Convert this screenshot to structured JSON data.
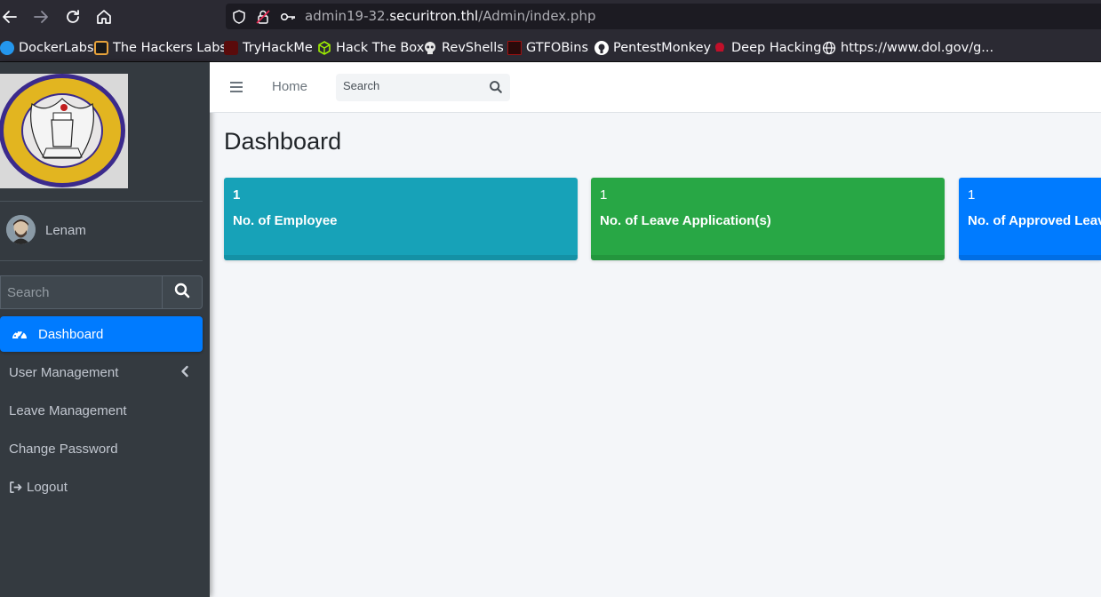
{
  "browser": {
    "url_prefix": "admin19-32.",
    "url_domain": "securitron.thl",
    "url_path": "/Admin/index.php",
    "bookmarks": [
      {
        "label": "DockerLabs",
        "icon": "docker-whale-icon",
        "color": "#2496ed"
      },
      {
        "label": "The Hackers Labs",
        "icon": "hackers-labs-icon",
        "color": "#e8a33b"
      },
      {
        "label": "TryHackMe",
        "icon": "tryhackme-icon",
        "color": "#c11111"
      },
      {
        "label": "Hack The Box",
        "icon": "hackthebox-cube-icon",
        "color": "#9fef00"
      },
      {
        "label": "RevShells",
        "icon": "skull-icon",
        "color": "#e0e0e0"
      },
      {
        "label": "GTFOBins",
        "icon": "gtfobins-icon",
        "color": "#a01010"
      },
      {
        "label": "PentestMonkey",
        "icon": "github-icon",
        "color": "#ffffff"
      },
      {
        "label": "Deep Hacking",
        "icon": "deep-hacking-icon",
        "color": "#c0102a"
      },
      {
        "label": "https://www.dol.gov/g...",
        "icon": "globe-icon",
        "color": "#fbfbfe"
      }
    ]
  },
  "sidebar": {
    "user_name": "Lenam",
    "search_placeholder": "Search",
    "items": [
      {
        "label": "Dashboard",
        "icon": "tachometer-icon",
        "active": true
      },
      {
        "label": "User Management",
        "icon": "",
        "has_submenu": true
      },
      {
        "label": "Leave Management",
        "icon": ""
      },
      {
        "label": "Change Password",
        "icon": ""
      },
      {
        "label": "Logout",
        "icon": "sign-out-icon"
      }
    ]
  },
  "topnav": {
    "home_label": "Home",
    "search_placeholder": "Search"
  },
  "main": {
    "title": "Dashboard",
    "boxes": [
      {
        "count": "1",
        "label": "No. of Employee",
        "color": "#17a2b8"
      },
      {
        "count": "1",
        "label": "No. of Leave Application(s)",
        "color": "#28a745"
      },
      {
        "count": "1",
        "label": "No. of Approved Leave",
        "color": "#007bff"
      }
    ]
  },
  "colors": {
    "sidebar_bg": "#343a40",
    "accent": "#007bff",
    "content_bg": "#f4f6f9"
  }
}
